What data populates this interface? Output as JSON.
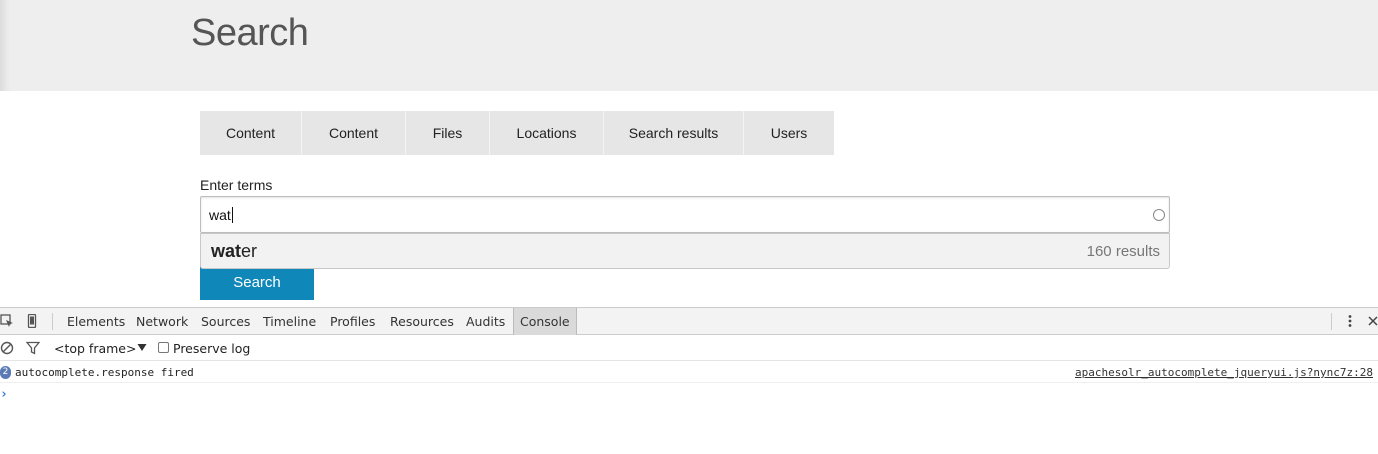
{
  "header": {
    "title": "Search"
  },
  "tabs": [
    {
      "label": "Content"
    },
    {
      "label": "Content"
    },
    {
      "label": "Files"
    },
    {
      "label": "Locations"
    },
    {
      "label": "Search results"
    },
    {
      "label": "Users"
    }
  ],
  "search": {
    "label": "Enter terms",
    "value": "wat",
    "button_label": "Search",
    "autocomplete": {
      "match": "wat",
      "rest": "er",
      "count": "160 results"
    }
  },
  "devtools": {
    "tabs": [
      "Elements",
      "Network",
      "Sources",
      "Timeline",
      "Profiles",
      "Resources",
      "Audits",
      "Console"
    ],
    "active_tab": "Console",
    "frame_selector": "<top frame>",
    "preserve_log_label": "Preserve log",
    "preserve_log_checked": false,
    "log": [
      {
        "repeat": "2",
        "message": "autocomplete.response fired",
        "source": "apachesolr_autocomplete_jqueryui.js?nync7z:28"
      }
    ],
    "prompt": "›"
  },
  "colors": {
    "header_bg": "#eeeeee",
    "button_bg": "#0f87b9",
    "tab_bg": "#e6e6e6"
  }
}
